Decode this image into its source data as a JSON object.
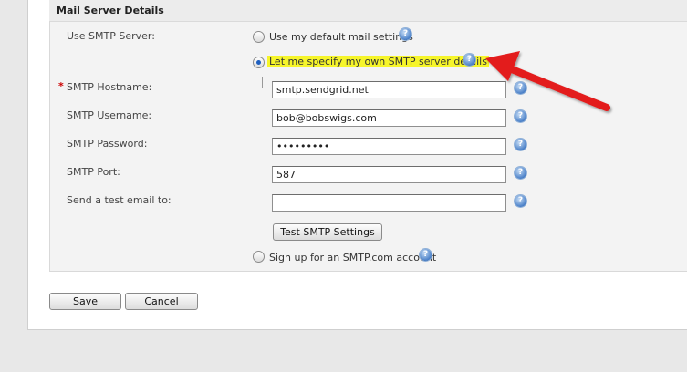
{
  "panel": {
    "title": "Mail Server Details"
  },
  "form": {
    "use_smtp_label": "Use SMTP Server:",
    "options": {
      "default": "Use my default mail settings",
      "own": "Let me specify my own SMTP server details",
      "signup": "Sign up for an SMTP.com account"
    },
    "selected_option": "own",
    "required_marker": "*",
    "hostname": {
      "label": "SMTP Hostname:",
      "value": "smtp.sendgrid.net"
    },
    "username": {
      "label": "SMTP Username:",
      "value": "bob@bobswigs.com"
    },
    "password": {
      "label": "SMTP Password:",
      "value": "•••••••••"
    },
    "port": {
      "label": "SMTP Port:",
      "value": "587"
    },
    "test_email": {
      "label": "Send a test email to:",
      "value": ""
    },
    "test_button": "Test SMTP Settings",
    "help_glyph": "?"
  },
  "footer": {
    "save_label": "Save",
    "cancel_label": "Cancel"
  },
  "colors": {
    "highlight": "#f6f52a",
    "arrow": "#e31b1b",
    "required": "#cc0000"
  }
}
